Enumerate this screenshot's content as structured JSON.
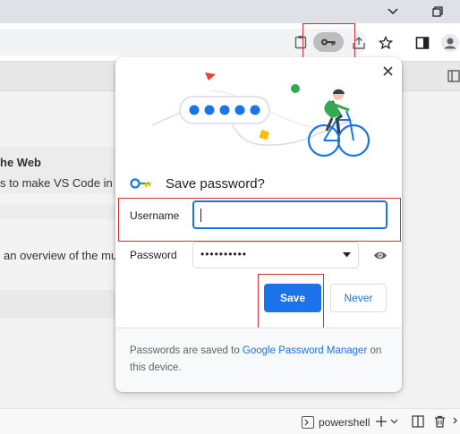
{
  "window": {
    "minimize_icon": "chevron-down-icon",
    "restore_icon": "restore-icon"
  },
  "page": {
    "heading": "he Web",
    "subtext": "s to make VS Code in th",
    "overview_text": "an overview of the mu"
  },
  "popup": {
    "title": "Save password?",
    "username_label": "Username",
    "username_value": "",
    "password_label": "Password",
    "password_value": "••••••••••",
    "save_label": "Save",
    "never_label": "Never",
    "footer_prefix": "Passwords are saved to ",
    "footer_link": "Google Password Manager",
    "footer_suffix": " on this device."
  },
  "statusbar": {
    "terminal_label": "powershell"
  },
  "colors": {
    "accent": "#1a73e8",
    "highlight_box": "#d32f2f"
  }
}
